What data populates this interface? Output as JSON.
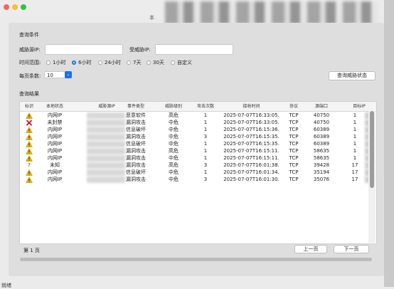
{
  "window": {
    "title": "本"
  },
  "filters": {
    "section_label": "查询条件",
    "source_ip_label": "威胁源IP:",
    "target_ip_label": "受威胁IP:",
    "source_ip_value": "",
    "target_ip_value": "",
    "time_range_label": "时间范围:",
    "time_options": [
      {
        "label": "1小时",
        "checked": false
      },
      {
        "label": "6小时",
        "checked": true
      },
      {
        "label": "24小时",
        "checked": false
      },
      {
        "label": "7天",
        "checked": false
      },
      {
        "label": "30天",
        "checked": false
      },
      {
        "label": "自定义",
        "checked": false
      }
    ],
    "page_size_label": "每页条数:",
    "page_size_value": "10",
    "query_button": "查询威胁状态"
  },
  "results": {
    "section_label": "查询结果",
    "columns": [
      "标识",
      "本地状态",
      "威胁源IP",
      "事件类型",
      "威胁级别",
      "攻击次数",
      "接收时间",
      "协议",
      "源端口",
      "目标IP"
    ],
    "rows": [
      {
        "icon": "warning-icon",
        "local": "内网IP",
        "event": "恶意软件",
        "level": "高危",
        "count": "1",
        "time": "2025-07-07T16:33:05.",
        "proto": "TCP",
        "port": "40750",
        "target": "1"
      },
      {
        "icon": "cross-icon",
        "local": "未封禁",
        "event": "漏洞攻击",
        "level": "中危",
        "count": "1",
        "time": "2025-07-07T16:33:05.",
        "proto": "TCP",
        "port": "40750",
        "target": "1"
      },
      {
        "icon": "warning-icon",
        "local": "内网IP",
        "event": "信息破坏",
        "level": "中危",
        "count": "1",
        "time": "2025-07-07T16:15:36.",
        "proto": "TCP",
        "port": "60389",
        "target": "1"
      },
      {
        "icon": "warning-icon",
        "local": "内网IP",
        "event": "漏洞攻击",
        "level": "中危",
        "count": "3",
        "time": "2025-07-07T16:15:35.",
        "proto": "TCP",
        "port": "60389",
        "target": "1"
      },
      {
        "icon": "warning-icon",
        "local": "内网IP",
        "event": "信息破坏",
        "level": "中危",
        "count": "1",
        "time": "2025-07-07T16:15:35.",
        "proto": "TCP",
        "port": "60389",
        "target": "1"
      },
      {
        "icon": "warning-icon",
        "local": "内网IP",
        "event": "漏洞攻击",
        "level": "高危",
        "count": "1",
        "time": "2025-07-07T16:15:11.",
        "proto": "TCP",
        "port": "58635",
        "target": "1"
      },
      {
        "icon": "warning-icon",
        "local": "内网IP",
        "event": "漏洞攻击",
        "level": "中危",
        "count": "1",
        "time": "2025-07-07T16:15:11.",
        "proto": "TCP",
        "port": "58635",
        "target": "1"
      },
      {
        "icon": "question-icon",
        "local": "未知",
        "event": "漏洞攻击",
        "level": "高危",
        "count": "3",
        "time": "2025-07-07T16:01:38.",
        "proto": "TCP",
        "port": "39428",
        "target": "17"
      },
      {
        "icon": "warning-icon",
        "local": "内网IP",
        "event": "信息破坏",
        "level": "中危",
        "count": "1",
        "time": "2025-07-07T16:01:34.",
        "proto": "TCP",
        "port": "35194",
        "target": "17"
      },
      {
        "icon": "warning-icon",
        "local": "内网IP",
        "event": "漏洞攻击",
        "level": "中危",
        "count": "3",
        "time": "2025-07-07T16:01:30.",
        "proto": "TCP",
        "port": "35076",
        "target": "17"
      }
    ]
  },
  "pagination": {
    "page_label": "第 1 页",
    "prev": "上一页",
    "next": "下一页"
  },
  "status_bar": {
    "text": "就绪"
  },
  "colors": {
    "accent": "#1e6fe8",
    "warning": "#f5b400",
    "error": "#d0021b"
  }
}
